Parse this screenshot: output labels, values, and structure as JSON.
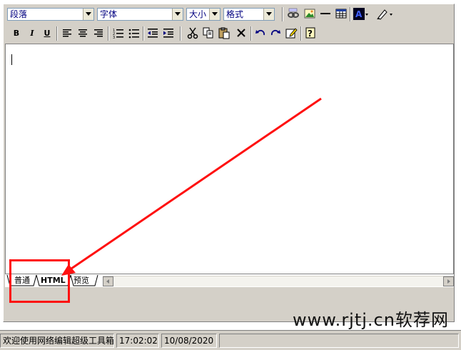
{
  "toolbar": {
    "paragraph_select": "段落",
    "font_select": "字体",
    "size_select": "大小",
    "format_select": "格式",
    "bold": "B",
    "italic": "I",
    "underline": "U"
  },
  "tabs": [
    {
      "label": "普通"
    },
    {
      "label": "HTML"
    },
    {
      "label": "预览"
    }
  ],
  "status": {
    "message": "欢迎使用网络编辑超级工具箱",
    "time": "17:02:02",
    "date": "10/08/2020"
  },
  "watermark": "www.rjtj.cn软荐网",
  "annotation_color": "#ff1010"
}
